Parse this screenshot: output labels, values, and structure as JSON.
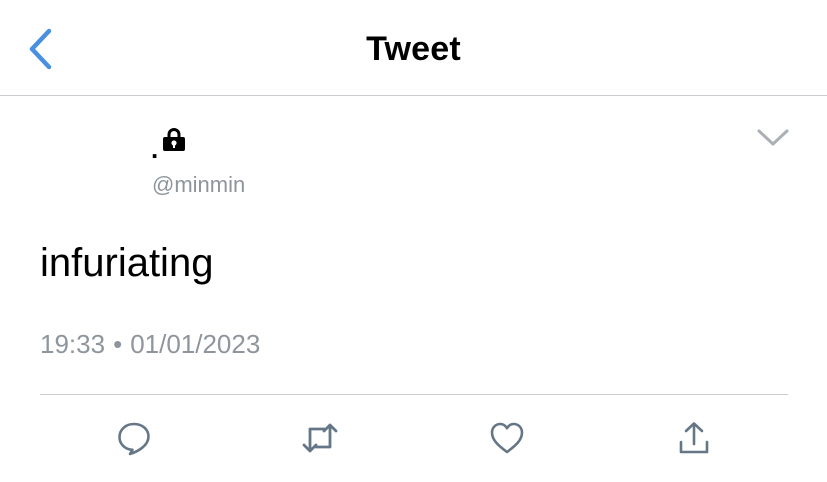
{
  "header": {
    "title": "Tweet",
    "back_icon": "chevron-left-icon"
  },
  "user": {
    "display_name_prefix": ".",
    "lock_icon": "lock-icon",
    "handle": "@minmin"
  },
  "tweet": {
    "text": "infuriating",
    "time": "19:33",
    "separator": "•",
    "date": "01/01/2023"
  },
  "actions": {
    "reply_icon": "reply-icon",
    "retweet_icon": "retweet-icon",
    "like_icon": "heart-icon",
    "share_icon": "share-icon"
  },
  "colors": {
    "accent": "#4a90e2",
    "muted": "#8e959d",
    "divider": "#c8ccd0"
  }
}
